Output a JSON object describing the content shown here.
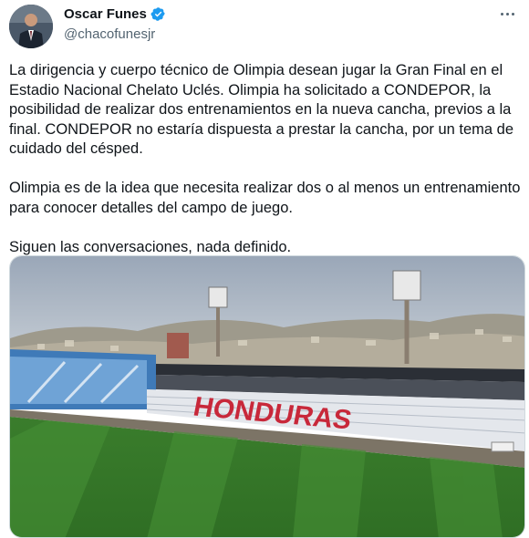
{
  "author": {
    "display_name": "Oscar Funes",
    "handle": "@chacofunesjr",
    "verified_icon": "verified-badge-icon",
    "avatar_icon": "profile-photo"
  },
  "menu": {
    "icon": "more-options-icon"
  },
  "tweet": {
    "paragraphs": [
      "La dirigencia y cuerpo técnico de Olimpia desean jugar la Gran Final en el Estadio Nacional Chelato Uclés. Olimpia ha solicitado a CONDEPOR, la posibilidad de realizar dos entrenamientos en la nueva cancha, previos a la final. CONDEPOR no estaría dispuesta a prestar la cancha, por un tema de cuidado del césped.",
      "Olimpia es de la idea que necesita realizar dos o al menos un entrenamiento para conocer detalles del campo de juego.",
      "Siguen las conversaciones, nada definido."
    ]
  },
  "media": {
    "stand_lettering": "HONDURAS",
    "colors": {
      "accent": "#1d9bf0",
      "grass": "#3f8a2f",
      "lettering": "#c8283a"
    }
  }
}
